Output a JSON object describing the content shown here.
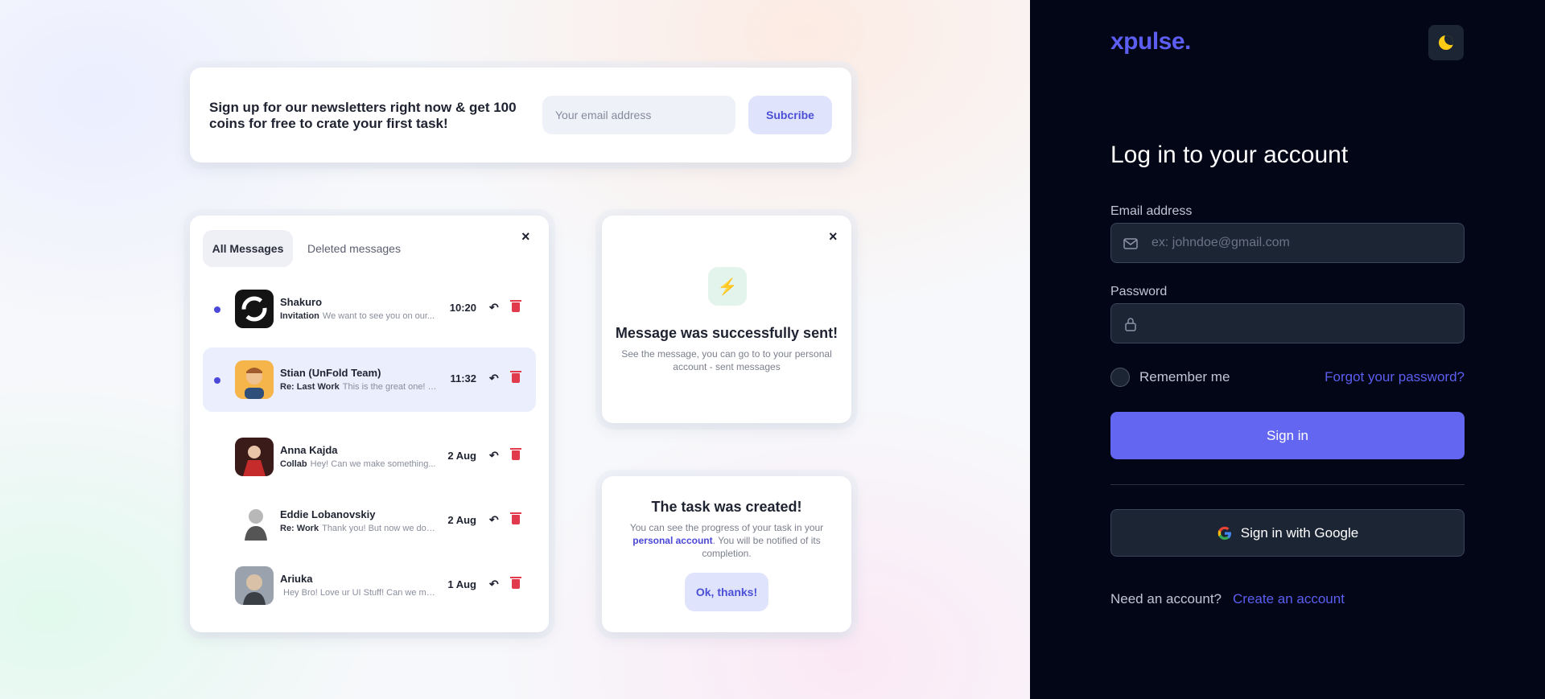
{
  "showcase": {
    "newsletter": {
      "text": "Sign up for our newsletters right now & get 100 coins for free to crate your first task!",
      "email_placeholder": "Your email address",
      "subscribe_label": "Subcribe"
    },
    "messages": {
      "tabs": [
        {
          "label": "All Messages",
          "active": true
        },
        {
          "label": "Deleted messages",
          "active": false
        }
      ],
      "close_icon": "×",
      "items": [
        {
          "name": "Shakuro",
          "tag": "Invitation",
          "preview": "We want to see you on our...",
          "time": "10:20",
          "unread": true,
          "highlighted": false,
          "avatar_color": "#141414"
        },
        {
          "name": "Stian (UnFold Team)",
          "tag": "Re: Last Work",
          "preview": "This is the great one! I lo...",
          "time": "11:32",
          "unread": true,
          "highlighted": true,
          "avatar_color": "#f5b54a"
        },
        {
          "name": "Anna Kajda",
          "tag": "Collab",
          "preview": "Hey! Can we make something...",
          "time": "2 Aug",
          "unread": false,
          "highlighted": false,
          "avatar_color": "#8c1f1f"
        },
        {
          "name": "Eddie Lobanovskiy",
          "tag": "Re: Work",
          "preview": "Thank you! But now we don...",
          "time": "2 Aug",
          "unread": false,
          "highlighted": false,
          "avatar_color": "#d9d9d9"
        },
        {
          "name": "Ariuka",
          "tag": "",
          "preview": "Hey Bro! Love ur UI Stuff! Can we mak...",
          "time": "1 Aug",
          "unread": false,
          "highlighted": false,
          "avatar_color": "#9aa3ad"
        }
      ]
    },
    "sent": {
      "icon": "⚡",
      "title": "Message was successfully sent!",
      "subtitle": "See the message, you can go to to your personal account - sent messages"
    },
    "task": {
      "title": "The task was created!",
      "sub_before": "You can see the progress of your task in your",
      "sub_link": "personal account",
      "sub_after": ". You will be notified of its completion.",
      "button_label": "Ok, thanks!"
    }
  },
  "login": {
    "logo": "xpulse.",
    "theme_icon": "moon-icon",
    "title": "Log in to your account",
    "email_label": "Email address",
    "email_placeholder": "ex: johndoe@gmail.com",
    "password_label": "Password",
    "remember_label": "Remember me",
    "forgot_label": "Forgot your password?",
    "signin_label": "Sign in",
    "google_label": "Sign in with Google",
    "need_account": "Need an account?",
    "create_account": "Create an account",
    "colors": {
      "accent": "#6366f1",
      "panel": "#030617",
      "field": "#1c2534"
    }
  }
}
